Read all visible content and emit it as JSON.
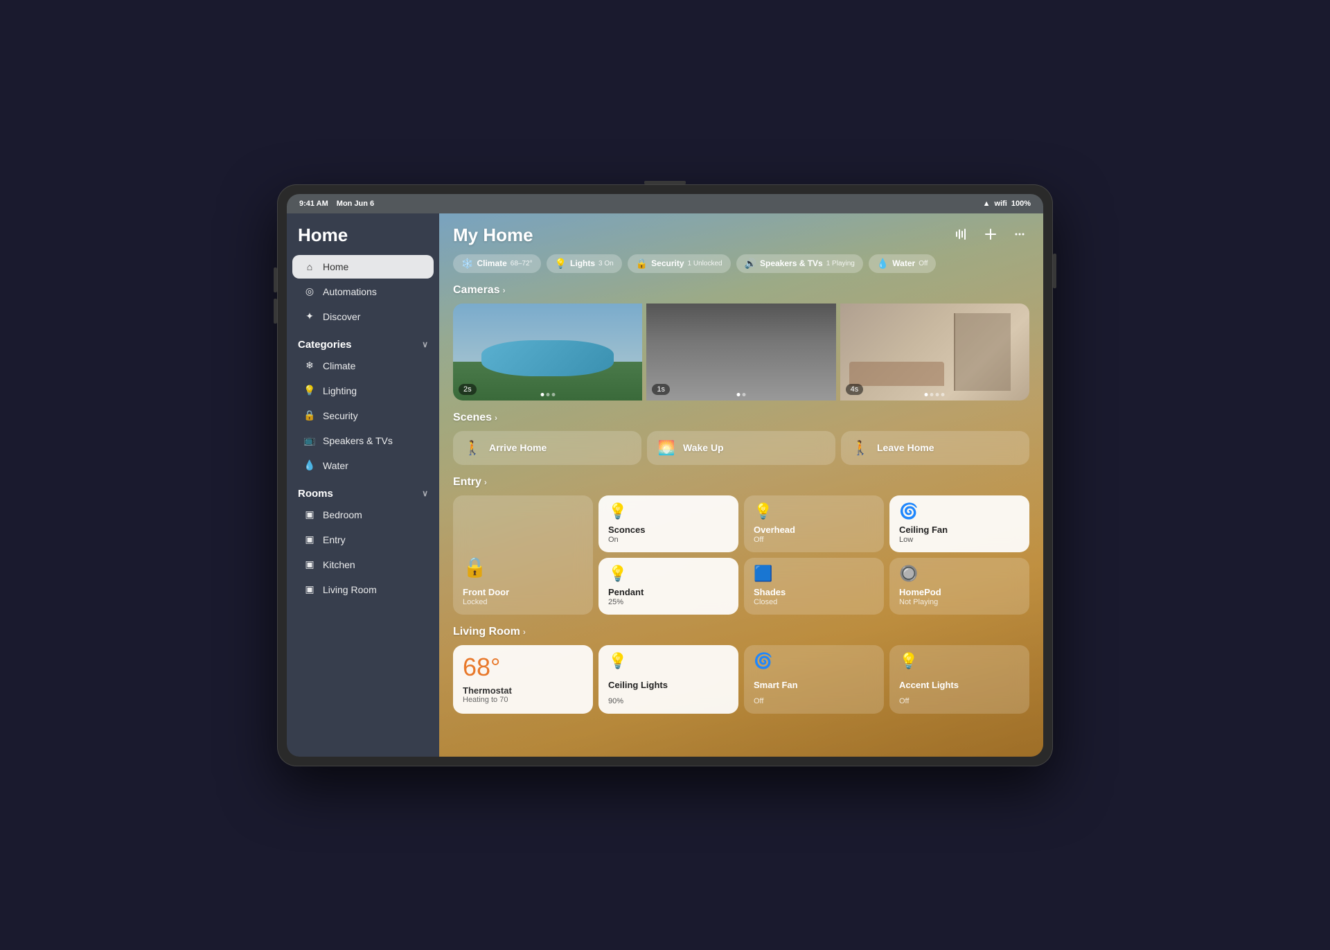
{
  "status_bar": {
    "time": "9:41 AM",
    "date": "Mon Jun 6",
    "signal": "●●●●",
    "wifi": "WiFi",
    "battery": "100%"
  },
  "sidebar": {
    "app_title": "Home",
    "nav_items": [
      {
        "id": "home",
        "label": "Home",
        "icon": "⌂",
        "active": true
      },
      {
        "id": "automations",
        "label": "Automations",
        "icon": "◎"
      },
      {
        "id": "discover",
        "label": "Discover",
        "icon": "✦"
      }
    ],
    "categories_title": "Categories",
    "categories": [
      {
        "id": "climate",
        "label": "Climate",
        "icon": "❄"
      },
      {
        "id": "lighting",
        "label": "Lighting",
        "icon": "💡"
      },
      {
        "id": "security",
        "label": "Security",
        "icon": "🔒"
      },
      {
        "id": "speakers",
        "label": "Speakers & TVs",
        "icon": "📺"
      },
      {
        "id": "water",
        "label": "Water",
        "icon": "💧"
      }
    ],
    "rooms_title": "Rooms",
    "rooms": [
      {
        "id": "bedroom",
        "label": "Bedroom",
        "icon": "▣"
      },
      {
        "id": "entry",
        "label": "Entry",
        "icon": "▣"
      },
      {
        "id": "kitchen",
        "label": "Kitchen",
        "icon": "▣"
      },
      {
        "id": "living_room",
        "label": "Living Room",
        "icon": "▣"
      }
    ]
  },
  "main": {
    "title": "My Home",
    "top_icons": {
      "siri": "🎙",
      "add": "+",
      "more": "···"
    },
    "pills": [
      {
        "id": "climate",
        "icon": "❄",
        "label": "Climate",
        "sub": "68–72°"
      },
      {
        "id": "lights",
        "icon": "💡",
        "label": "Lights",
        "sub": "3 On"
      },
      {
        "id": "security",
        "icon": "🔒",
        "label": "Security",
        "sub": "1 Unlocked"
      },
      {
        "id": "speakers",
        "icon": "🔊",
        "label": "Speakers & TVs",
        "sub": "1 Playing"
      },
      {
        "id": "water",
        "icon": "💧",
        "label": "Water",
        "sub": "Off"
      }
    ],
    "cameras_section": "Cameras",
    "cameras": [
      {
        "id": "pool",
        "badge": "2s",
        "type": "pool"
      },
      {
        "id": "garage",
        "badge": "1s",
        "type": "garage"
      },
      {
        "id": "room",
        "badge": "4s",
        "type": "room"
      }
    ],
    "scenes_section": "Scenes",
    "scenes": [
      {
        "id": "arrive",
        "icon": "🚶",
        "label": "Arrive Home"
      },
      {
        "id": "wakeup",
        "icon": "🌅",
        "label": "Wake Up"
      },
      {
        "id": "leave",
        "icon": "🚶",
        "label": "Leave Home"
      }
    ],
    "entry_section": "Entry",
    "entry_devices": [
      {
        "id": "front_door",
        "icon": "🔒",
        "label": "Front Door",
        "status": "Locked",
        "active": false,
        "is_door": true
      },
      {
        "id": "sconces",
        "icon": "💡",
        "label": "Sconces",
        "status": "On",
        "active": true
      },
      {
        "id": "overhead",
        "icon": "💡",
        "label": "Overhead",
        "status": "Off",
        "active": false
      },
      {
        "id": "ceiling_fan_entry",
        "icon": "🌀",
        "label": "Ceiling Fan",
        "status": "Low",
        "active": true
      },
      {
        "id": "pendant",
        "icon": "💡",
        "label": "Pendant",
        "status": "25%",
        "active": true
      },
      {
        "id": "shades",
        "icon": "▬",
        "label": "Shades",
        "status": "Closed",
        "active": false
      },
      {
        "id": "homepod",
        "icon": "●",
        "label": "HomePod",
        "status": "Not Playing",
        "active": false
      }
    ],
    "living_room_section": "Living Room",
    "living_room_devices": [
      {
        "id": "thermostat",
        "is_thermostat": true,
        "temp": "68°",
        "label": "Thermostat",
        "status": "Heating to 70"
      },
      {
        "id": "ceiling_lights",
        "icon": "💡",
        "label": "Ceiling Lights",
        "status": "90%",
        "active": true
      },
      {
        "id": "smart_fan",
        "icon": "🌀",
        "label": "Smart Fan",
        "status": "Off",
        "active": false
      },
      {
        "id": "accent_lights",
        "icon": "💡",
        "label": "Accent Lights",
        "status": "Off",
        "active": false
      }
    ]
  }
}
